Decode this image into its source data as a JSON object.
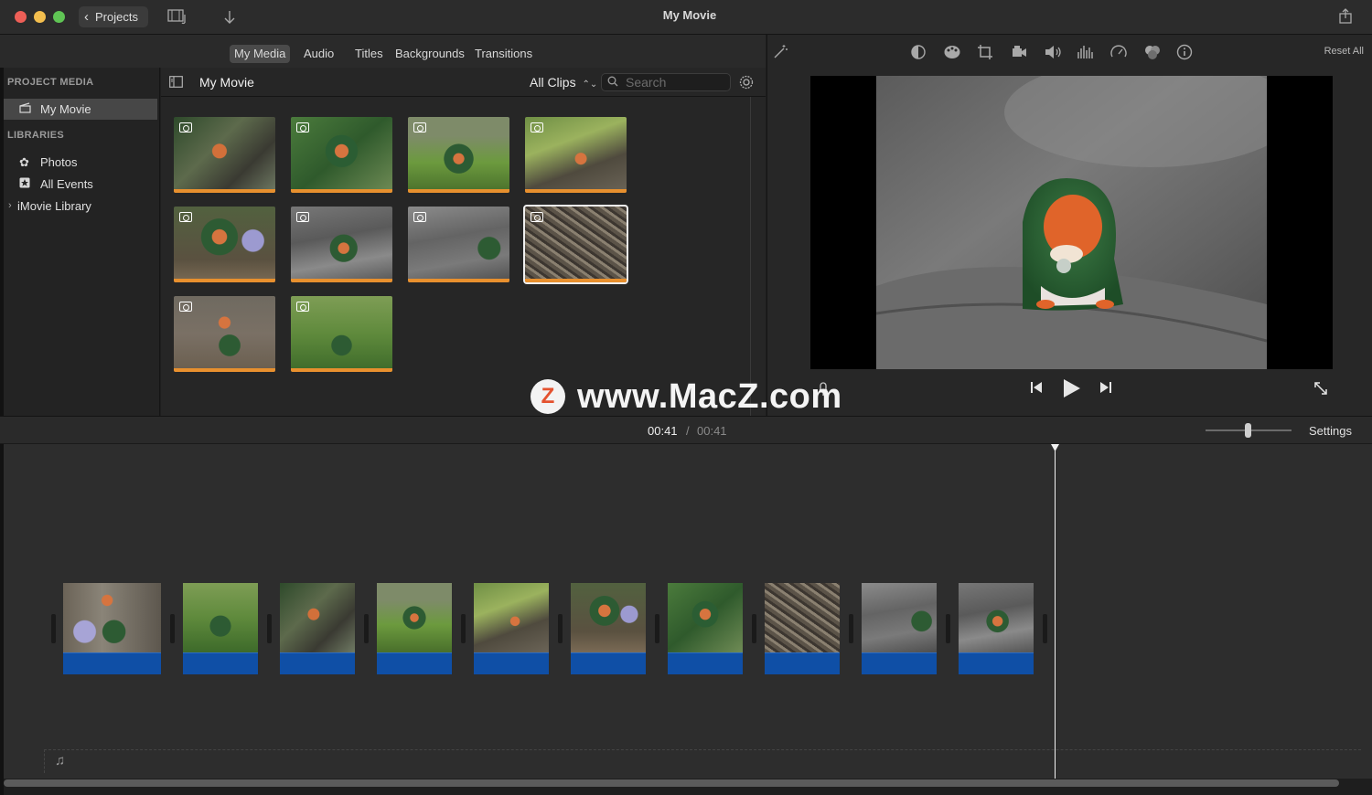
{
  "window": {
    "title": "My Movie",
    "projects_label": "Projects"
  },
  "browser_tabs": [
    {
      "label": "My Media",
      "active": true
    },
    {
      "label": "Audio",
      "active": false
    },
    {
      "label": "Titles",
      "active": false
    },
    {
      "label": "Backgrounds",
      "active": false
    },
    {
      "label": "Transitions",
      "active": false
    }
  ],
  "sidebar": {
    "project_media_heading": "PROJECT MEDIA",
    "project_item": "My Movie",
    "libraries_heading": "LIBRARIES",
    "libraries": [
      {
        "label": "Photos",
        "icon": "photos-icon"
      },
      {
        "label": "All Events",
        "icon": "star-icon"
      },
      {
        "label": "iMovie Library",
        "icon": "disclosure-chevron-icon"
      }
    ]
  },
  "browser": {
    "title": "My Movie",
    "filter": "All Clips",
    "search_placeholder": "Search"
  },
  "viewer": {
    "reset_all": "Reset All"
  },
  "timeline": {
    "current_time": "00:41",
    "separator": "/",
    "total_time": "00:41",
    "settings_label": "Settings"
  },
  "watermark": {
    "logo_letter": "Z",
    "text": "www.MacZ.com"
  },
  "colors": {
    "audio_bar": "#0f4fa6",
    "clip_used_bar": "#e8902e",
    "background": "#1e1e1e"
  }
}
